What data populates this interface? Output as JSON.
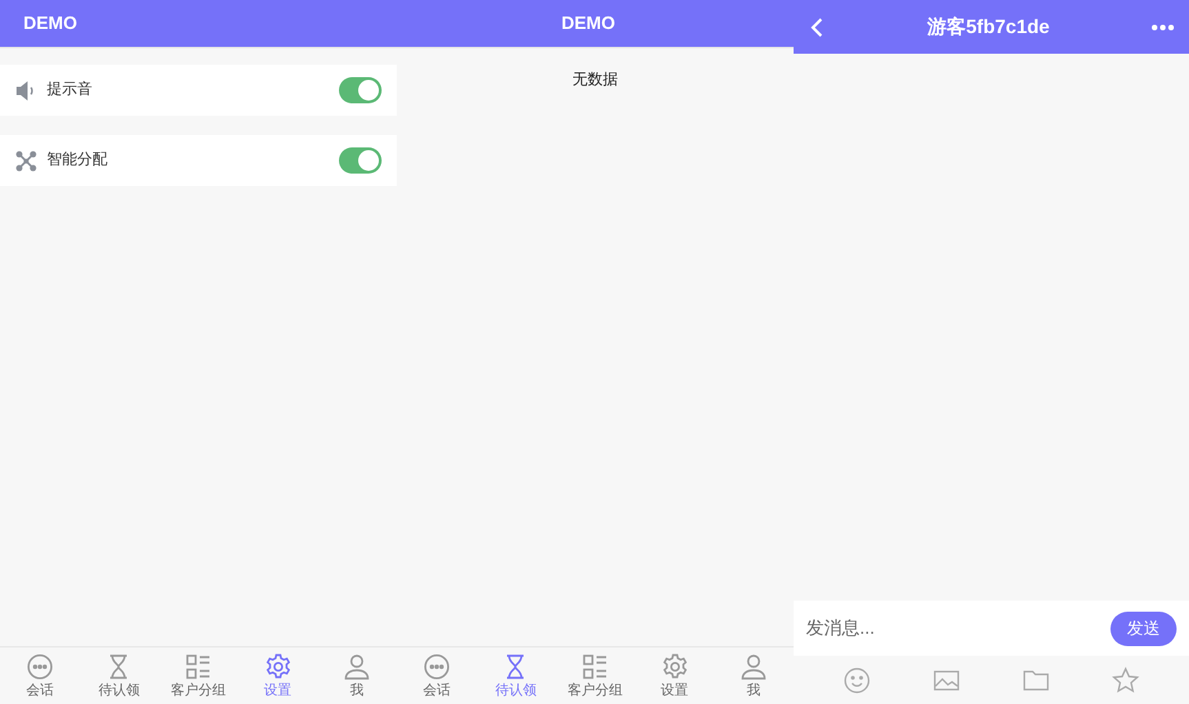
{
  "settings_pane": {
    "title": "DEMO",
    "settings": [
      {
        "kind": "sound",
        "label": "提示音",
        "on": true
      },
      {
        "kind": "assign",
        "label": "智能分配",
        "on": true
      }
    ],
    "tabs": [
      {
        "kind": "chat",
        "label": "会话",
        "selected": false
      },
      {
        "kind": "hourglass",
        "label": "待认领",
        "selected": false
      },
      {
        "kind": "groups",
        "label": "客户分组",
        "selected": false
      },
      {
        "kind": "gear",
        "label": "设置",
        "selected": true
      },
      {
        "kind": "person",
        "label": "我",
        "selected": false
      }
    ]
  },
  "pending_pane": {
    "title": "DEMO",
    "empty_text": "无数据",
    "tabs": [
      {
        "kind": "chat",
        "label": "会话",
        "selected": false
      },
      {
        "kind": "hourglass",
        "label": "待认领",
        "selected": true
      },
      {
        "kind": "groups",
        "label": "客户分组",
        "selected": false
      },
      {
        "kind": "gear",
        "label": "设置",
        "selected": false
      },
      {
        "kind": "person",
        "label": "我",
        "selected": false
      }
    ]
  },
  "chat_pane": {
    "title": "游客5fb7c1de",
    "input": {
      "placeholder": "发消息..."
    },
    "send_button": "发送",
    "tools": [
      {
        "kind": "emoji"
      },
      {
        "kind": "image"
      },
      {
        "kind": "folder"
      },
      {
        "kind": "star"
      }
    ]
  }
}
